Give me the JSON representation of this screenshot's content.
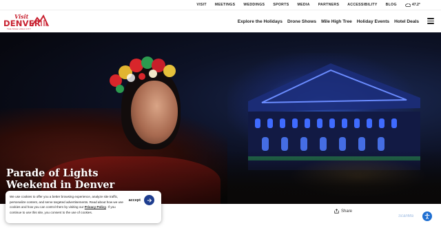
{
  "utility_nav": {
    "links": [
      "VISIT",
      "MEETINGS",
      "WEDDINGS",
      "SPORTS",
      "MEDIA",
      "PARTNERS",
      "ACCESSIBILITY",
      "BLOG"
    ],
    "weather": "47.2°"
  },
  "logo": {
    "visit": "Visit",
    "denver": "DENVER",
    "tagline": "THE MILE HIGH CITY"
  },
  "main_nav": {
    "links": [
      "Explore the Holidays",
      "Drone Shows",
      "Mile High Tree",
      "Holiday Events",
      "Hotel Deals"
    ]
  },
  "hero": {
    "title": "Parade of Lights Weekend in Denver 2025"
  },
  "share": {
    "label": "Share"
  },
  "cookie": {
    "text_before": "We use cookies to offer you a better browsing experience, analyze site traffic, personalize content, and serve targeted advertisements.  Read about how we use cookies and how you can control them by visiting our ",
    "policy_link": "Privacy Policy",
    "text_after": ".  If you continue to use this site, you consent to the use of cookies.",
    "accept_label": "accept"
  },
  "badge": {
    "label": "ScanMa"
  },
  "colors": {
    "brand_red": "#c8202f",
    "accept_blue": "#1e3d8f",
    "a11y_blue": "#1f6fd1"
  }
}
